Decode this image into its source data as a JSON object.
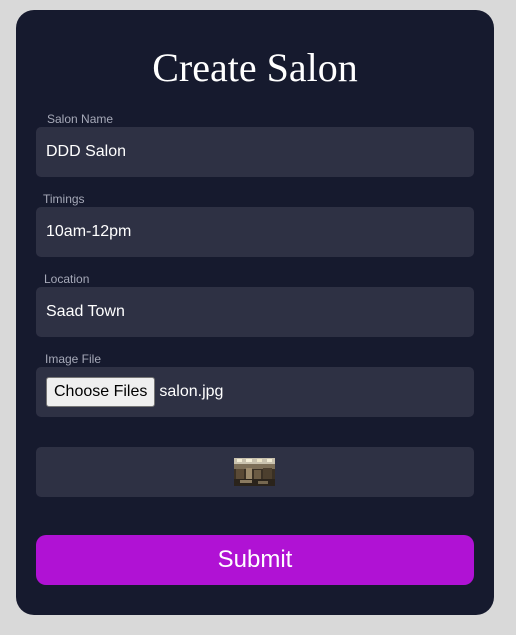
{
  "form": {
    "title": "Create Salon",
    "fields": [
      {
        "label": "Salon Name",
        "value": "DDD Salon"
      },
      {
        "label": "Timings",
        "value": "10am-12pm"
      },
      {
        "label": "Location",
        "value": "Saad Town"
      }
    ],
    "image_file": {
      "label": "Image File",
      "button_label": "Choose Files",
      "file_name": "salon.jpg"
    },
    "preview": {
      "icon": "salon-photo-thumbnail"
    },
    "submit_label": "Submit"
  },
  "colors": {
    "page_background": "#d9d9d9",
    "card_background": "#161a2e",
    "field_background": "#2e3144",
    "label_text": "#a6a9b8",
    "submit_background": "#b012d4"
  }
}
